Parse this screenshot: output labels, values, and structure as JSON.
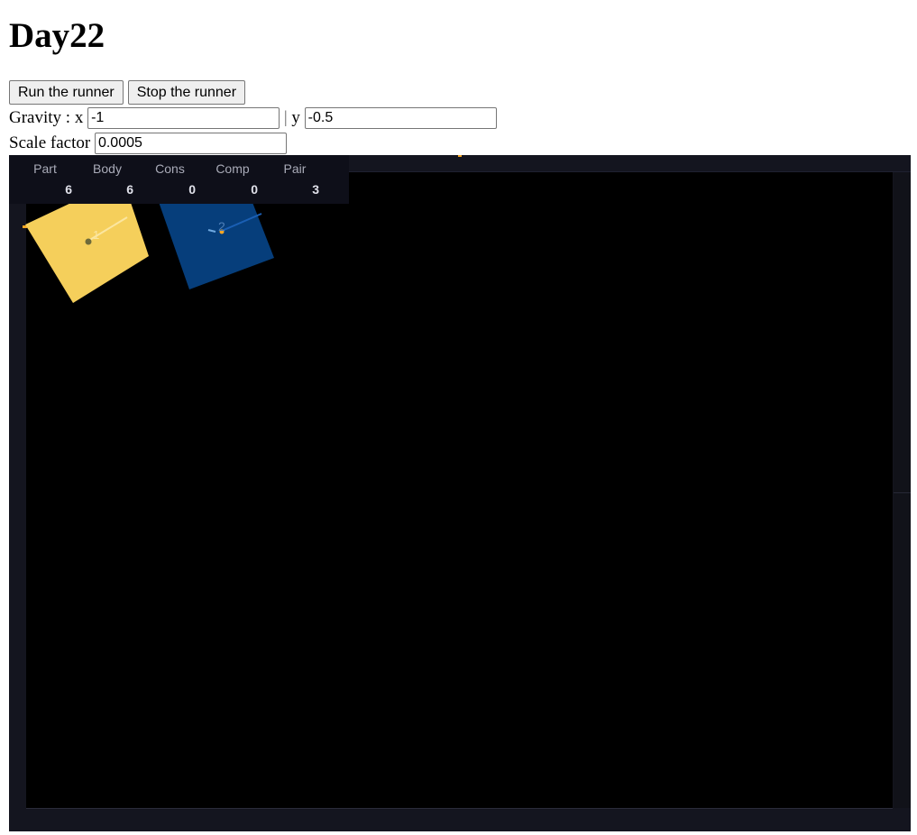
{
  "page": {
    "title": "Day22"
  },
  "controls": {
    "run_label": "Run the runner",
    "stop_label": "Stop the runner",
    "gravity_label": "Gravity : x ",
    "gravity_x": "-1",
    "gravity_sep": " | ",
    "gravity_y_label": "y ",
    "gravity_y": "-0.5",
    "scale_label": "Scale factor ",
    "scale_value": "0.0005"
  },
  "stats": [
    {
      "label": "Part",
      "value": "6"
    },
    {
      "label": "Body",
      "value": "6"
    },
    {
      "label": "Cons",
      "value": "0"
    },
    {
      "label": "Comp",
      "value": "0"
    },
    {
      "label": "Pair",
      "value": "3"
    }
  ],
  "bodies": [
    {
      "id": "1",
      "color": "#f5cf5b"
    },
    {
      "id": "2",
      "color": "#063e7b"
    }
  ],
  "colors": {
    "background": "#000000",
    "wall": "#14151f",
    "accent": "#f5a623"
  }
}
